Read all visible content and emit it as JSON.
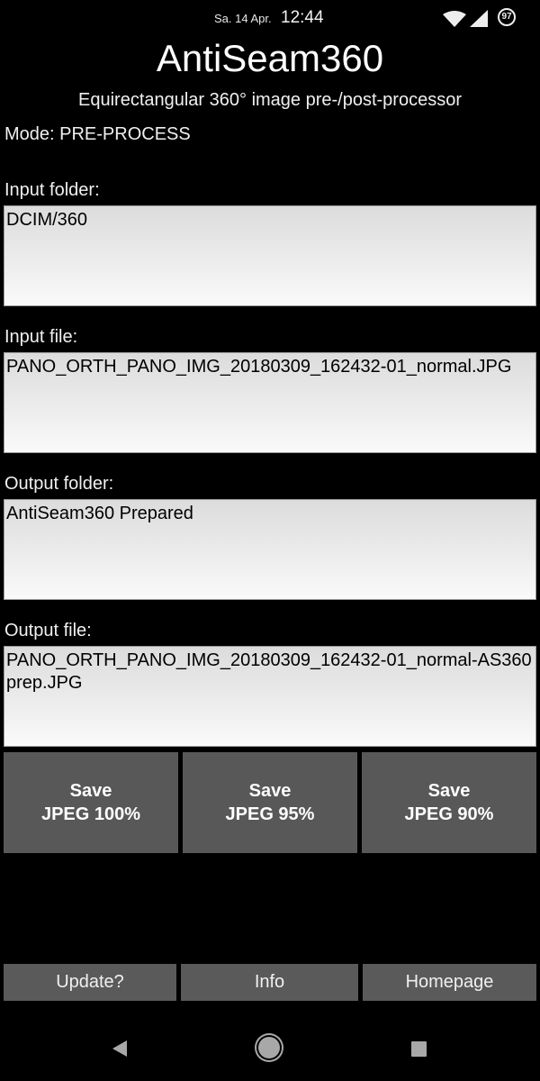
{
  "status_bar": {
    "date": "Sa. 14 Apr.",
    "time": "12:44",
    "battery": "97",
    "icons": [
      "wifi-icon",
      "signal-icon",
      "battery-icon"
    ]
  },
  "app": {
    "title": "AntiSeam360",
    "subtitle": "Equirectangular 360° image pre-/post-processor",
    "mode": "Mode: PRE-PROCESS"
  },
  "fields": [
    {
      "label": "Input folder:",
      "value": "DCIM/360"
    },
    {
      "label": "Input file:",
      "value": "PANO_ORTH_PANO_IMG_20180309_162432-01_normal.JPG"
    },
    {
      "label": "Output folder:",
      "value": "AntiSeam360 Prepared"
    },
    {
      "label": "Output file:",
      "value": "PANO_ORTH_PANO_IMG_20180309_162432-01_normal-AS360prep.JPG"
    }
  ],
  "save_buttons": [
    {
      "line1": "Save",
      "line2": "JPEG 100%"
    },
    {
      "line1": "Save",
      "line2": "JPEG 95%"
    },
    {
      "line1": "Save",
      "line2": "JPEG 90%"
    }
  ],
  "bottom_buttons": [
    {
      "label": "Update?"
    },
    {
      "label": "Info"
    },
    {
      "label": "Homepage"
    }
  ],
  "navbar": {
    "icons": [
      "back-icon",
      "home-icon",
      "recents-icon"
    ]
  },
  "colors": {
    "background": "#000000",
    "button": "#585858",
    "field_top": "#dcdcdc",
    "field_bottom": "#fafafa"
  }
}
